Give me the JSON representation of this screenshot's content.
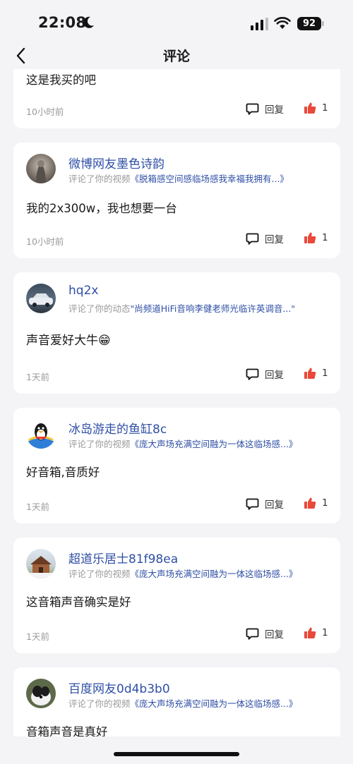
{
  "status_bar": {
    "time": "22:08",
    "battery": "92"
  },
  "header": {
    "title": "评论"
  },
  "labels": {
    "reply": "回复",
    "commented_video": "评论了你的视频",
    "commented_dynamic": "评论了你的动态"
  },
  "comments": [
    {
      "author": "",
      "content": "这是我买的吧",
      "time": "10小时前",
      "likes": "1"
    },
    {
      "author": "微博网友墨色诗韵",
      "target_type": "评论了你的视频",
      "target": "《脱箱感空间感临场感我幸福我拥有...》",
      "content": "我的2x300w，我也想要一台",
      "time": "10小时前",
      "likes": "1"
    },
    {
      "author": "hq2x",
      "target_type": "评论了你的动态",
      "target": "\"尚频道HiFi音响李健老师光临许英调音...\"",
      "content": "声音爱好大牛😁",
      "time": "1天前",
      "likes": "1"
    },
    {
      "author": "冰岛游走的鱼缸8c",
      "target_type": "评论了你的视频",
      "target": "《庞大声场充满空间融为一体这临场感...》",
      "content": "好音箱,音质好",
      "time": "1天前",
      "likes": "1"
    },
    {
      "author": "超道乐居士81f98ea",
      "target_type": "评论了你的视频",
      "target": "《庞大声场充满空间融为一体这临场感...》",
      "content": "这音箱声音确实是好",
      "time": "1天前",
      "likes": "1"
    },
    {
      "author": "百度网友0d4b3b0",
      "target_type": "评论了你的视频",
      "target": "《庞大声场充满空间融为一体这临场感...》",
      "content": "音箱声音是真好",
      "time": "",
      "likes": ""
    }
  ]
}
